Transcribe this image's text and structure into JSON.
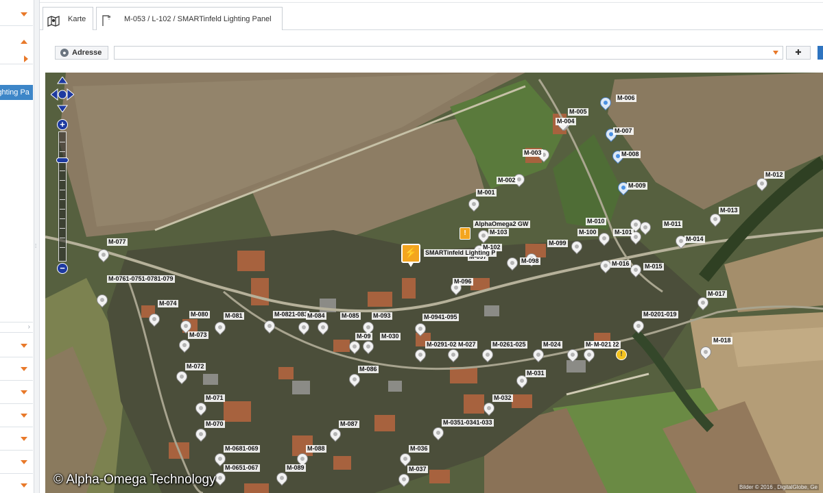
{
  "tabs": [
    {
      "label": "Karte",
      "icon": "map-icon"
    },
    {
      "label": "M-053 / L-102 / SMARTinfeld Lighting Panel",
      "icon": "street-lamp-icon"
    }
  ],
  "sidebar": {
    "selected_item": "ighting Pa",
    "accordion_icon": "chevron-down-icon"
  },
  "address": {
    "button_label": "Adresse",
    "input_value": "",
    "pin_icon": "pin-icon"
  },
  "map": {
    "special": {
      "panel": "SMARTinfeld Lighting P",
      "gateway": "AlphaOmega2 GW"
    },
    "markers": [
      {
        "label": "M-006",
        "variant": "alt"
      },
      {
        "label": "M-005"
      },
      {
        "label": "M-007",
        "variant": "alt"
      },
      {
        "label": "M-004"
      },
      {
        "label": "M-008",
        "variant": "alt"
      },
      {
        "label": "M-003"
      },
      {
        "label": "M-009",
        "variant": "alt"
      },
      {
        "label": "M-012"
      },
      {
        "label": "M-002"
      },
      {
        "label": "M-013"
      },
      {
        "label": "M-001"
      },
      {
        "label": "M-010"
      },
      {
        "label": "M-011"
      },
      {
        "label": "M-014"
      },
      {
        "label": "M-103"
      },
      {
        "label": "M-100"
      },
      {
        "label": "M-101"
      },
      {
        "label": "M-099"
      },
      {
        "label": "M-102"
      },
      {
        "label": "M-098"
      },
      {
        "label": "M-097"
      },
      {
        "label": "M-016"
      },
      {
        "label": "M-015"
      },
      {
        "label": "M-077"
      },
      {
        "label": "M-096"
      },
      {
        "label": "M-017"
      },
      {
        "label": "M-0761-0751-0781-079"
      },
      {
        "label": "M-074"
      },
      {
        "label": "M-080"
      },
      {
        "label": "M-081"
      },
      {
        "label": "M-0821-083"
      },
      {
        "label": "M-084"
      },
      {
        "label": "M-085"
      },
      {
        "label": "M-093"
      },
      {
        "label": "M-0941-095"
      },
      {
        "label": "M-0201-019"
      },
      {
        "label": "M-073"
      },
      {
        "label": "M-018"
      },
      {
        "label": "M-09"
      },
      {
        "label": "M-030"
      },
      {
        "label": "M-0291-028"
      },
      {
        "label": "M-027"
      },
      {
        "label": "M-0261-025"
      },
      {
        "label": "M-024"
      },
      {
        "label": "M-0231-022"
      },
      {
        "label": "M-021"
      },
      {
        "label": "M-072"
      },
      {
        "label": "M-086"
      },
      {
        "label": "M-031"
      },
      {
        "label": "M-071"
      },
      {
        "label": "M-032"
      },
      {
        "label": "M-070"
      },
      {
        "label": "M-087"
      },
      {
        "label": "M-0351-0341-033"
      },
      {
        "label": "M-0681-069"
      },
      {
        "label": "M-088"
      },
      {
        "label": "M-036"
      },
      {
        "label": "M-0651-067"
      },
      {
        "label": "M-089"
      },
      {
        "label": "M-037"
      }
    ],
    "attribution": "Bilder © 2016 , DigitalGlobe, Ge",
    "copyright": "© Alpha-Omega Technology"
  }
}
